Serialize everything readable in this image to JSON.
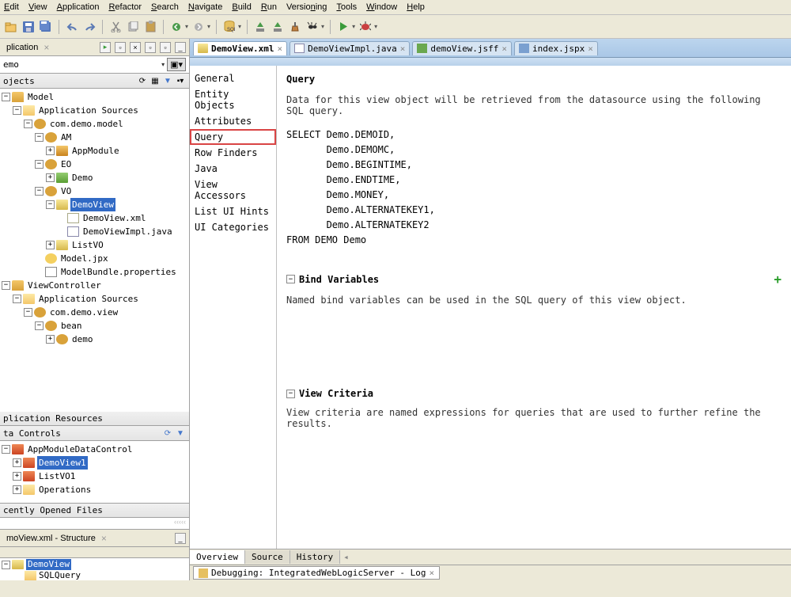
{
  "menu": [
    "Edit",
    "View",
    "Application",
    "Refactor",
    "Search",
    "Navigate",
    "Build",
    "Run",
    "Versioning",
    "Tools",
    "Window",
    "Help"
  ],
  "left_panel_tab": "plication",
  "search_value": "emo",
  "projects_header": "ojects",
  "tree": {
    "model": "Model",
    "app_sources": "Application Sources",
    "pkg_model": "com.demo.model",
    "am": "AM",
    "appmodule": "AppModule",
    "eo": "EO",
    "demo_eo": "Demo",
    "vo": "VO",
    "demoview": "DemoView",
    "demoview_xml": "DemoView.xml",
    "demoview_impl": "DemoViewImpl.java",
    "listvo": "ListVO",
    "model_jpx": "Model.jpx",
    "model_bundle": "ModelBundle.properties",
    "viewcontroller": "ViewController",
    "app_sources2": "Application Sources",
    "pkg_view": "com.demo.view",
    "bean": "bean",
    "demo_bean": "demo"
  },
  "app_resources": "plication Resources",
  "data_controls_header": "ta Controls",
  "dc": {
    "root": "AppModuleDataControl",
    "dv1": "DemoView1",
    "lv1": "ListVO1",
    "ops": "Operations"
  },
  "recent_header": "cently Opened Files",
  "structure_header": "moView.xml - Structure",
  "structure": {
    "root": "DemoView",
    "sql": "SQLQuery"
  },
  "editor_tabs": [
    {
      "label": "DemoView.xml",
      "active": true
    },
    {
      "label": "DemoViewImpl.java",
      "active": false
    },
    {
      "label": "demoView.jsff",
      "active": false
    },
    {
      "label": "index.jspx",
      "active": false
    }
  ],
  "nav_items": [
    "General",
    "Entity Objects",
    "Attributes",
    "Query",
    "Row Finders",
    "Java",
    "View Accessors",
    "List UI Hints",
    "UI Categories"
  ],
  "nav_selected": "Query",
  "query": {
    "title": "Query",
    "desc": "Data for this view object will be retrieved from the datasource using the following SQL query.",
    "sql": "SELECT Demo.DEMOID,\n       Demo.DEMOMC,\n       Demo.BEGINTIME,\n       Demo.ENDTIME,\n       Demo.MONEY,\n       Demo.ALTERNATEKEY1,\n       Demo.ALTERNATEKEY2\nFROM DEMO Demo"
  },
  "bind": {
    "title": "Bind Variables",
    "desc": "Named bind variables can be used in the SQL query of this view object."
  },
  "criteria": {
    "title": "View Criteria",
    "desc": "View criteria are named expressions for queries that are used to further refine the results."
  },
  "bottom_tabs": [
    "Overview",
    "Source",
    "History"
  ],
  "debug_label": "Debugging: IntegratedWebLogicServer - Log"
}
